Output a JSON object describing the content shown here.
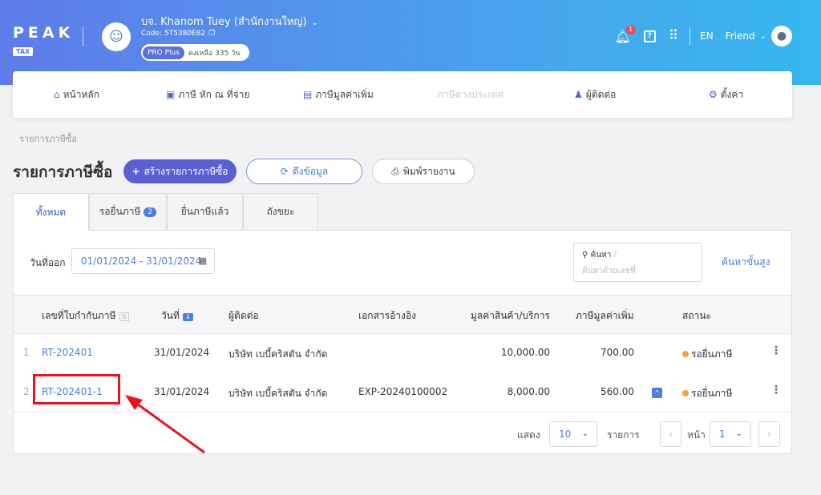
{
  "header": {
    "logo_text": "PEAK",
    "logo_sub": "TAX",
    "company_name": "บจ. Khanom Tuey (สำนักงานใหญ่)",
    "company_code": "Code: 5T5380E82",
    "plan": "PRO Plus",
    "plan_remaining": "คงเหลือ 335 วัน",
    "notification_count": "1",
    "language": "EN",
    "user_name": "Friend"
  },
  "nav": {
    "home": "หน้าหลัก",
    "withholding": "ภาษี หัก ณ ที่จ่าย",
    "vat": "ภาษีมูลค่าเพิ่ม",
    "foreign": "ภาษีต่างประเทศ",
    "contacts": "ผู้ติดต่อ",
    "settings": "ตั้งค่า"
  },
  "breadcrumb": "รายการภาษีซื้อ",
  "page": {
    "title": "รายการภาษีซื้อ",
    "create_button": "สร้างรายการภาษีซื้อ",
    "fetch_button": "ดึงข้อมูล",
    "print_button": "พิมพ์รายงาน"
  },
  "tabs": [
    {
      "label": "ทั้งหมด"
    },
    {
      "label": "รอยื่นภาษี",
      "count": "2"
    },
    {
      "label": "ยื่นภาษีแล้ว"
    },
    {
      "label": "ถังขยะ"
    }
  ],
  "filters": {
    "date_label": "วันที่ออก",
    "date_range": "01/01/2024 - 31/01/2024",
    "search_label": "ค้นหา",
    "search_placeholder": "ค้นหาด้วยเลขที่",
    "advanced_search": "ค้นหาขั้นสูง"
  },
  "table": {
    "headers": {
      "doc_no": "เลขที่ใบกำกับภาษี",
      "date": "วันที่",
      "contact": "ผู้ติดต่อ",
      "reference": "เอกสารอ้างอิง",
      "amount": "มูลค่าสินค้า/บริการ",
      "vat": "ภาษีมูลค่าเพิ่ม",
      "status": "สถานะ"
    },
    "rows": [
      {
        "index": "1",
        "doc_no": "RT-202401",
        "date": "31/01/2024",
        "contact": "บริษัท เบบี้คริสตัน จำกัด",
        "reference": "",
        "amount": "10,000.00",
        "vat": "700.00",
        "status": "รอยื่นภาษี"
      },
      {
        "index": "2",
        "doc_no": "RT-202401-1",
        "date": "31/01/2024",
        "contact": "บริษัท เบบี้คริสตัน จำกัด",
        "reference": "EXP-20240100002",
        "amount": "8,000.00",
        "vat": "560.00",
        "status": "รอยื่นภาษี"
      }
    ]
  },
  "pagination": {
    "show_label": "แสดง",
    "page_size": "10",
    "items_label": "รายการ",
    "page_label": "หน้า",
    "page": "1"
  },
  "colors": {
    "accent": "#4a7ee0",
    "primary_button": "#5b5fd2",
    "status_pending": "#f5a03a",
    "highlight": "#e8141b"
  }
}
